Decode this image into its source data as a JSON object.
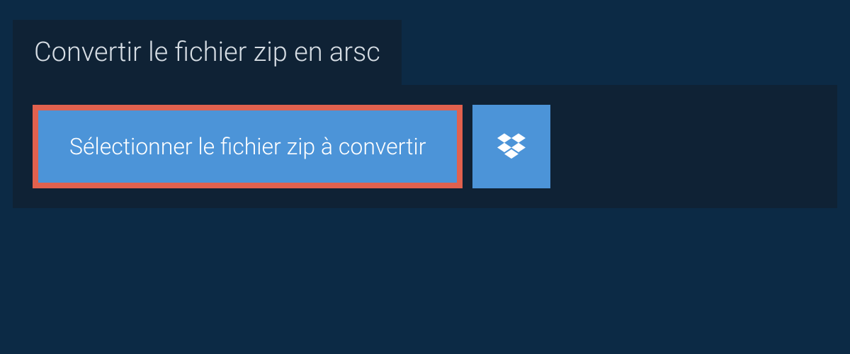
{
  "header": {
    "title": "Convertir le fichier zip en arsc"
  },
  "actions": {
    "select_file_label": "Sélectionner le fichier zip à convertir"
  },
  "colors": {
    "background": "#0c2a45",
    "panel": "#0f2235",
    "button_primary": "#4c94d8",
    "highlight_border": "#e1614e"
  }
}
